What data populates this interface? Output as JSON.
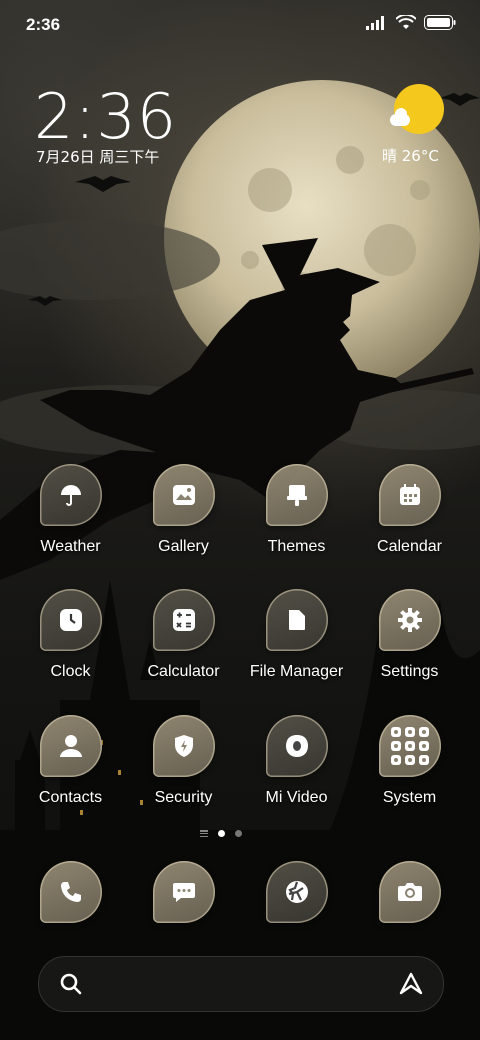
{
  "status_bar": {
    "time": "2:36",
    "icons": [
      "signal-icon",
      "wifi-icon",
      "battery-icon"
    ]
  },
  "clock_widget": {
    "time": "2:36",
    "date": "7月26日 周三下午"
  },
  "weather_widget": {
    "text": "晴 26°C",
    "icon": "sun-cloud-icon"
  },
  "apps": [
    {
      "label": "Weather",
      "icon": "umbrella-icon"
    },
    {
      "label": "Gallery",
      "icon": "image-icon"
    },
    {
      "label": "Themes",
      "icon": "brush-icon"
    },
    {
      "label": "Calendar",
      "icon": "calendar-icon"
    },
    {
      "label": "Clock",
      "icon": "clock-icon"
    },
    {
      "label": "Calculator",
      "icon": "calculator-icon"
    },
    {
      "label": "File Manager",
      "icon": "folder-icon"
    },
    {
      "label": "Settings",
      "icon": "gear-icon"
    },
    {
      "label": "Contacts",
      "icon": "person-icon"
    },
    {
      "label": "Security",
      "icon": "shield-icon"
    },
    {
      "label": "Mi Video",
      "icon": "video-icon"
    },
    {
      "label": "System",
      "icon": "folder-grid-icon"
    }
  ],
  "page_indicator": {
    "pages": 2,
    "active": 1
  },
  "dock": [
    {
      "icon": "phone-icon"
    },
    {
      "icon": "message-icon"
    },
    {
      "icon": "browser-icon"
    },
    {
      "icon": "camera-icon"
    }
  ],
  "search_bar": {
    "left_icon": "search-icon",
    "right_icon": "assistant-icon"
  }
}
